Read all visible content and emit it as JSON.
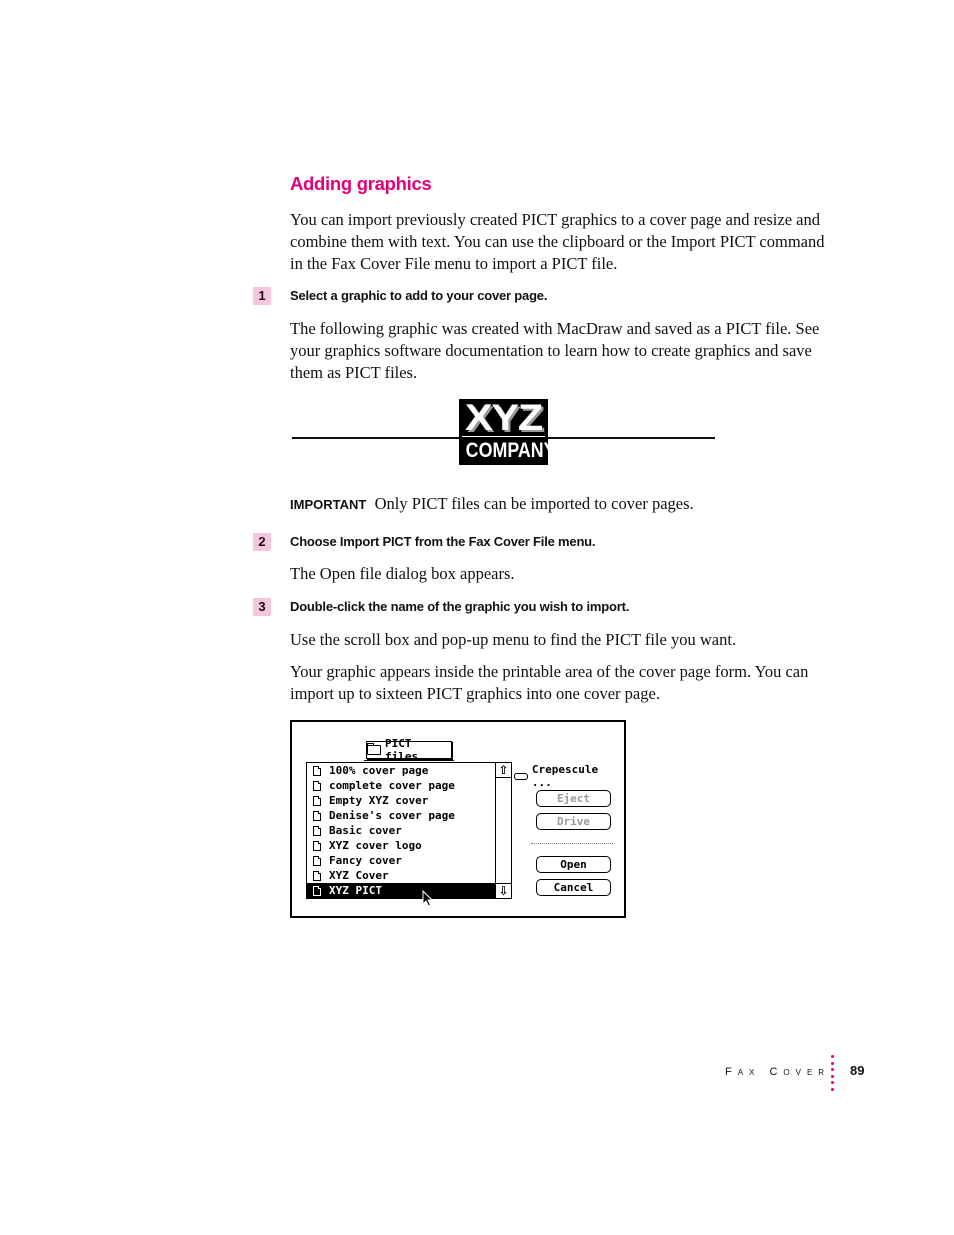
{
  "section": {
    "heading": "Adding graphics",
    "intro": "You can import previously created PICT graphics to a cover page and resize and combine them with text. You can use the clipboard or the Import PICT command in the Fax Cover File menu to import a PICT file."
  },
  "steps": [
    {
      "number": "1",
      "instruction": "Select a graphic to add to your cover page.",
      "body": "The following graphic was created with MacDraw and saved as a PICT file. See your graphics software documentation to learn how to create graphics and save them as PICT files."
    },
    {
      "number": "2",
      "instruction": "Choose Import PICT from the Fax Cover File menu.",
      "body": "The Open file dialog box appears."
    },
    {
      "number": "3",
      "instruction": "Double-click the name of the graphic you wish to import.",
      "body": "Use the scroll box and pop-up menu to find the PICT file you want.",
      "body2": "Your graphic appears inside the printable area of the cover page form. You can import up to sixteen PICT graphics into one cover page."
    }
  ],
  "logo": {
    "line1": "XYZ",
    "line2": "COMPANY"
  },
  "important": {
    "label": "IMPORTANT",
    "text": "Only PICT files can be imported to cover pages."
  },
  "dialog": {
    "folder_popup": "PICT files",
    "disk_name": "Crepescule ...",
    "files": [
      "100% cover page",
      "complete cover page",
      "Empty XYZ cover",
      "Denise's cover page",
      "Basic cover",
      "XYZ cover logo",
      "Fancy cover",
      "XYZ Cover",
      "XYZ PICT"
    ],
    "selected_file": "XYZ PICT",
    "buttons": {
      "eject": "Eject",
      "drive": "Drive",
      "open": "Open",
      "cancel": "Cancel"
    }
  },
  "footer": {
    "chapter": "Fax Cover",
    "page_number": "89"
  },
  "colors": {
    "accent": "#e4007c",
    "step_badge": "#f6c6de"
  }
}
